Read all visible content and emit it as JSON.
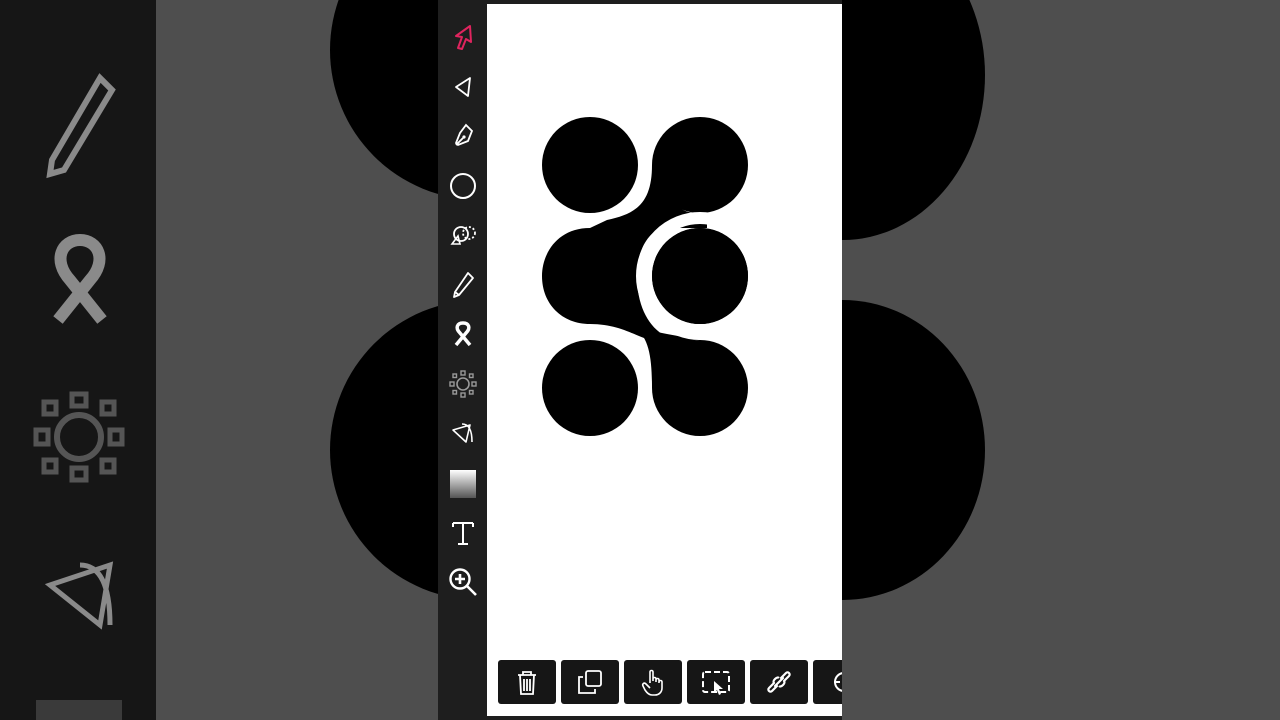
{
  "app": {
    "canvas_color": "#ffffff",
    "accent_color": "#e0245e",
    "toolbar_color": "#1e1e1e"
  },
  "tools": [
    {
      "name": "selection-tool",
      "icon": "selection-arrow-icon",
      "active": true
    },
    {
      "name": "direct-selection-tool",
      "icon": "direct-arrow-icon",
      "active": false
    },
    {
      "name": "pen-tool",
      "icon": "pen-nib-icon",
      "active": false
    },
    {
      "name": "ellipse-tool",
      "icon": "circle-icon",
      "active": false
    },
    {
      "name": "shape-builder-tool",
      "icon": "shape-builder-icon",
      "active": false
    },
    {
      "name": "pencil-tool",
      "icon": "pencil-icon",
      "active": false
    },
    {
      "name": "blend-tool",
      "icon": "ribbon-icon",
      "active": false
    },
    {
      "name": "symbol-tool",
      "icon": "sun-sprayer-icon",
      "active": false
    },
    {
      "name": "corner-tool",
      "icon": "corner-arrow-icon",
      "active": false
    },
    {
      "name": "gradient-tool",
      "icon": "gradient-icon",
      "active": false
    },
    {
      "name": "text-tool",
      "icon": "text-icon",
      "active": false
    },
    {
      "name": "zoom-tool",
      "icon": "zoom-in-icon",
      "active": false
    }
  ],
  "actions": [
    {
      "name": "delete-button",
      "icon": "trash-icon"
    },
    {
      "name": "duplicate-button",
      "icon": "copy-icon"
    },
    {
      "name": "pan-button",
      "icon": "hand-pointer-icon"
    },
    {
      "name": "select-area-button",
      "icon": "marquee-pointer-icon"
    },
    {
      "name": "link-button",
      "icon": "link-icon"
    },
    {
      "name": "more-button",
      "icon": "partial-icon"
    }
  ],
  "artwork": {
    "name": "connected-dots-logo",
    "fill": "#000000"
  }
}
